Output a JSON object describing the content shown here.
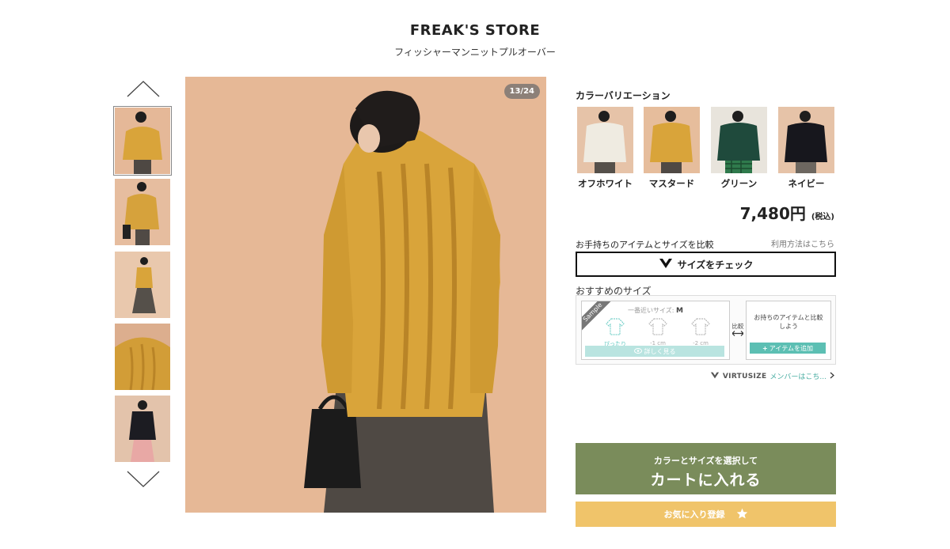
{
  "header": {
    "brand": "FREAK'S STORE",
    "product_name": "フィッシャーマンニットプルオーバー"
  },
  "gallery": {
    "counter": "13/24",
    "nav_up_icon": "chevron-up-icon",
    "nav_down_icon": "chevron-down-icon",
    "thumbnails": [
      "thumb-1",
      "thumb-2",
      "thumb-3",
      "thumb-4",
      "thumb-5"
    ],
    "active_thumbnail": 0
  },
  "color_variation": {
    "title": "カラーバリエーション",
    "colors": [
      {
        "label": "オフホワイト"
      },
      {
        "label": "マスタード"
      },
      {
        "label": "グリーン"
      },
      {
        "label": "ネイビー"
      }
    ]
  },
  "price": {
    "amount": "7,480円",
    "tax": "(税込)"
  },
  "size_check": {
    "compare_label": "お手持ちのアイテムとサイズを比較",
    "howto_link": "利用方法はこちら",
    "button_label": "サイズをチェック"
  },
  "recommended": {
    "label": "おすすめのサイズ",
    "sample_tag": "Sample",
    "best_size_prefix": "一番近いサイズ:",
    "best_size_value": "M",
    "fits": [
      "ぴったり",
      "-1 cm",
      "-2 cm"
    ],
    "detail_button": "詳しく見る",
    "compare_text": "比較",
    "right_message": "お持ちのアイテムと比較しよう",
    "add_button": "アイテムを追加"
  },
  "virtusize": {
    "brand": "VIRTUSIZE",
    "member_link": "メンバーはこち..."
  },
  "cart": {
    "sub_label": "カラーとサイズを選択して",
    "main_label": "カートに入れる"
  },
  "favorite": {
    "label": "お気に入り登録"
  },
  "colors": {
    "cart": "#7a8c5b",
    "favorite": "#f0c46a",
    "teal": "#5cbfb3",
    "mustard": "#d9a43a"
  }
}
